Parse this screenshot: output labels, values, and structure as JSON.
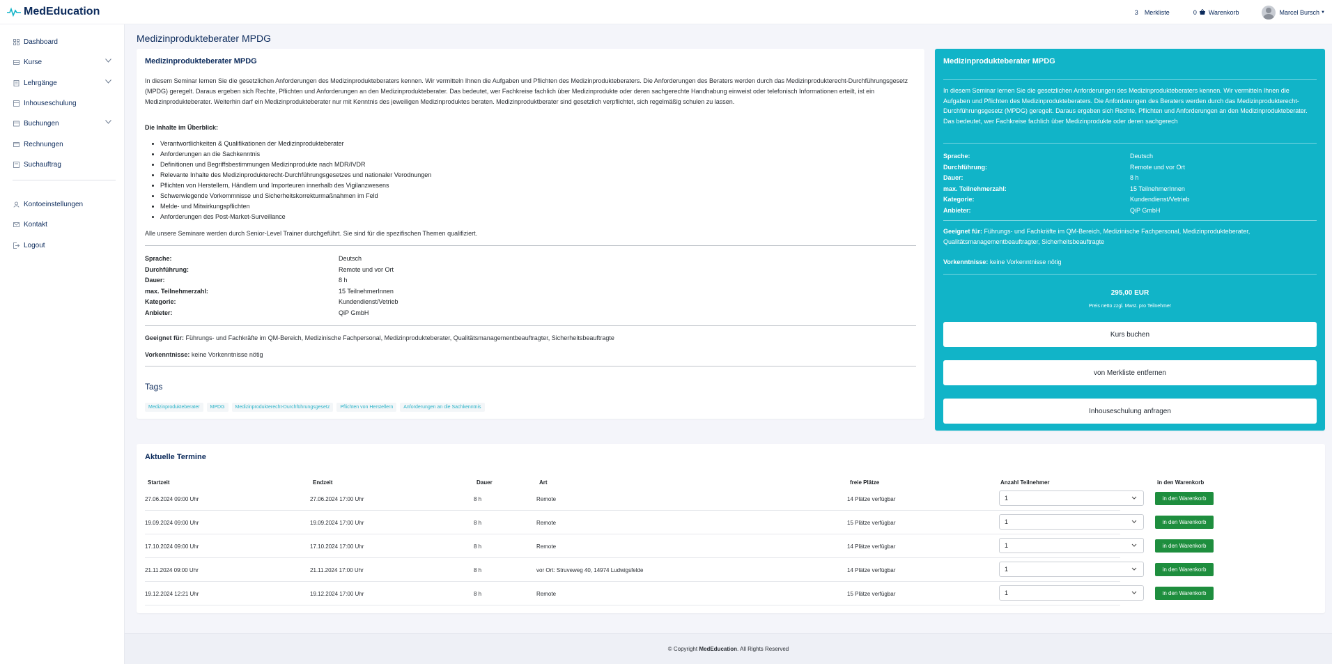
{
  "brand": {
    "name": "MedEducation"
  },
  "topnav": {
    "watchlist": {
      "count": "3",
      "label": "Merkliste"
    },
    "cart": {
      "count": "0",
      "label": "Warenkorb"
    },
    "user": {
      "name": "Marcel Bursch"
    }
  },
  "sidebar": {
    "items": [
      {
        "label": "Dashboard",
        "icon": "grid-icon"
      },
      {
        "label": "Kurse",
        "icon": "courses-icon"
      },
      {
        "label": "Lehrgänge",
        "icon": "curriculum-icon"
      },
      {
        "label": "Inhouseschulung",
        "icon": "inhouse-icon"
      },
      {
        "label": "Buchungen",
        "icon": "bookings-icon"
      },
      {
        "label": "Rechnungen",
        "icon": "invoices-icon"
      },
      {
        "label": "Suchauftrag",
        "icon": "search-order-icon"
      },
      {
        "label": "Kontoeinstellungen",
        "icon": "user-icon"
      },
      {
        "label": "Kontakt",
        "icon": "mail-icon"
      },
      {
        "label": "Logout",
        "icon": "logout-icon"
      }
    ]
  },
  "page": {
    "title": "Medizinprodukteberater MPDG"
  },
  "course": {
    "title": "Medizinprodukteberater MPDG",
    "description": "In diesem Seminar lernen Sie die gesetzlichen Anforderungen des Medizinprodukteberaters kennen. Wir vermitteln Ihnen die Aufgaben und Pflichten des Medizinprodukteberaters. Die Anforderungen des Beraters werden durch das Medizinprodukterecht-Durchführungsgesetz (MPDG) geregelt. Daraus ergeben sich Rechte, Pflichten und Anforderungen an den Medizinprodukteberater. Das bedeutet, wer Fachkreise fachlich über Medizinprodukte oder deren sachgerechte Handhabung einweist oder telefonisch Informationen erteilt, ist ein Medizinprodukteberater. Weiterhin darf ein Medizinprodukteberater nur mit Kenntnis des jeweiligen Medizinproduktes beraten. Medizinproduktberater sind gesetzlich verpflichtet, sich regelmäßig schulen zu lassen.",
    "overview_heading": "Die Inhalte im Überblick:",
    "contents": [
      "Verantwortlichkeiten & Qualifikationen der Medizinprodukteberater",
      "Anforderungen an die Sachkenntnis",
      "Definitionen und Begriffsbestimmungen Medizinprodukte nach MDR/IVDR",
      "Relevante Inhalte des Medizinprodukterecht-Durchführungsgesetzes und nationaler Verodnungen",
      "Pflichten von Herstellern, Händlern und Importeuren innerhalb des Vigilanzwesens",
      "Schwerwiegende Vorkommnisse und Sicherheitskorrekturmaßnahmen im Feld",
      "Melde- und Mitwirkungspflichten",
      "Anforderungen des Post-Market-Surveillance"
    ],
    "trainer_note": "Alle unsere Seminare werden durch Senior-Level Trainer durchgeführt. Sie sind für die spezifischen Themen qualifiziert.",
    "details": [
      {
        "key": "Sprache:",
        "value": "Deutsch"
      },
      {
        "key": "Durchführung:",
        "value": "Remote und vor Ort"
      },
      {
        "key": "Dauer:",
        "value": "8 h"
      },
      {
        "key": "max. Teilnehmerzahl:",
        "value": "15 TeilnehmerInnen"
      },
      {
        "key": "Kategorie:",
        "value": "Kundendienst/Vetrieb"
      },
      {
        "key": "Anbieter:",
        "value": "QiP GmbH"
      }
    ],
    "suitable_label": "Geeignet für:",
    "suitable_value": "Führungs- und Fachkräfte im QM-Bereich, Medizinische Fachpersonal, Medizinprodukteberater, Qualitätsmanagementbeauftragter, Sicherheitsbeauftragte",
    "prereq_label": "Vorkenntnisse:",
    "prereq_value": "keine Vorkenntnisse nötig",
    "tags_heading": "Tags",
    "tags": [
      "Medizinprodukteberater",
      "MPDG",
      "Medizinprodukterecht-Durchführungsgesetz",
      "Pflichten von Herstellern",
      "Anforderungen an die Sachkenntnis"
    ]
  },
  "summary": {
    "title": "Medizinprodukteberater MPDG",
    "description": "In diesem Seminar lernen Sie die gesetzlichen Anforderungen des Medizinprodukteberaters kennen. Wir vermitteln Ihnen die Aufgaben und Pflichten des Medizinprodukteberaters. Die Anforderungen des Beraters werden durch das Medizinprodukterecht-Durchführungsgesetz (MPDG) geregelt. Daraus ergeben sich Rechte, Pflichten und Anforderungen an den Medizinprodukteberater. Das bedeutet, wer Fachkreise fachlich über Medizinprodukte oder deren sachgerech",
    "details": [
      {
        "key": "Sprache:",
        "value": "Deutsch"
      },
      {
        "key": "Durchführung:",
        "value": "Remote und vor Ort"
      },
      {
        "key": "Dauer:",
        "value": "8 h"
      },
      {
        "key": "max. Teilnehmerzahl:",
        "value": "15 TeilnehmerInnen"
      },
      {
        "key": "Kategorie:",
        "value": "Kundendienst/Vetrieb"
      },
      {
        "key": "Anbieter:",
        "value": "QiP GmbH"
      }
    ],
    "suitable_label": "Geeignet für:",
    "suitable_value": "Führungs- und Fachkräfte im QM-Bereich, Medizinische Fachpersonal, Medizinprodukteberater, Qualitätsmanagementbeauftragter, Sicherheitsbeauftragte",
    "prereq_label": "Vorkenntnisse:",
    "prereq_value": "keine Vorkenntnisse nötig",
    "price": "295,00 EUR",
    "price_note": "Preis netto zzgl. Mwst. pro Teilnehmer",
    "book_label": "Kurs buchen",
    "unwatch_label": "von Merkliste entfernen",
    "inhouse_label": "Inhouseschulung anfragen"
  },
  "dates": {
    "title": "Aktuelle Termine",
    "columns": [
      "Startzeit",
      "Endzeit",
      "Dauer",
      "Art",
      "freie Plätze",
      "Anzahl Teilnehmer",
      "in den Warenkorb"
    ],
    "rows": [
      {
        "start": "27.06.2024 09:00 Uhr",
        "end": "27.06.2024 17:00 Uhr",
        "duration": "8 h",
        "type": "Remote",
        "seats": "14 Plätze verfügbar",
        "qty": "1",
        "btn": "in den Warenkorb"
      },
      {
        "start": "19.09.2024 09:00 Uhr",
        "end": "19.09.2024 17:00 Uhr",
        "duration": "8 h",
        "type": "Remote",
        "seats": "15 Plätze verfügbar",
        "qty": "1",
        "btn": "in den Warenkorb"
      },
      {
        "start": "17.10.2024 09:00 Uhr",
        "end": "17.10.2024 17:00 Uhr",
        "duration": "8 h",
        "type": "Remote",
        "seats": "14 Plätze verfügbar",
        "qty": "1",
        "btn": "in den Warenkorb"
      },
      {
        "start": "21.11.2024 09:00 Uhr",
        "end": "21.11.2024 17:00 Uhr",
        "duration": "8 h",
        "type": "vor Ort: Struveweg 40, 14974 Ludwigsfelde",
        "seats": "14 Plätze verfügbar",
        "qty": "1",
        "btn": "in den Warenkorb"
      },
      {
        "start": "19.12.2024 12:21 Uhr",
        "end": "19.12.2024 17:00 Uhr",
        "duration": "8 h",
        "type": "Remote",
        "seats": "15 Plätze verfügbar",
        "qty": "1",
        "btn": "in den Warenkorb"
      }
    ]
  },
  "footer": {
    "prefix": "© Copyright",
    "brand": "MedEducation",
    "suffix": ". All Rights Reserved"
  },
  "colors": {
    "accent": "#11b4c8",
    "brand": "#0b2a5b",
    "cart_button": "#1e8e3e"
  }
}
